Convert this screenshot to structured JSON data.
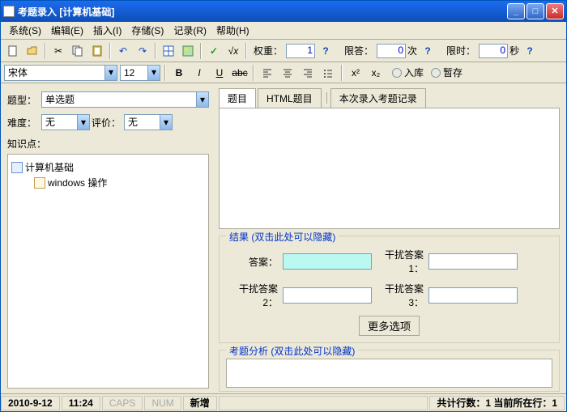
{
  "title": "考题录入 [计算机基础]",
  "menu": [
    "系统(S)",
    "编辑(E)",
    "插入(I)",
    "存储(S)",
    "记录(R)",
    "帮助(H)"
  ],
  "toolbar": {
    "weight_label": "权重：",
    "weight_value": "1",
    "limit_answer_label": "限答：",
    "limit_answer_value": "0",
    "limit_answer_unit": "次",
    "limit_time_label": "限时：",
    "limit_time_value": "0",
    "limit_time_unit": "秒"
  },
  "format": {
    "font": "宋体",
    "size": "12",
    "radio_store": "入库",
    "radio_temp": "暂存"
  },
  "left": {
    "type_label": "题型：",
    "type_value": "单选题",
    "difficulty_label": "难度：",
    "difficulty_value": "无",
    "rating_label": "评价：",
    "rating_value": "无",
    "knowledge_label": "知识点：",
    "tree_root": "计算机基础",
    "tree_child": "windows 操作"
  },
  "tabs": {
    "t1": "题目",
    "t2": "HTML题目",
    "t3": "本次录入考题记录"
  },
  "result": {
    "caption": "结果 (双击此处可以隐藏)",
    "answer_label": "答案：",
    "d1_label": "干扰答案1：",
    "d2_label": "干扰答案2：",
    "d3_label": "干扰答案3：",
    "more": "更多选项"
  },
  "analysis": {
    "caption": "考题分析 (双击此处可以隐藏)"
  },
  "status": {
    "date": "2010-9-12",
    "time": "11:24",
    "caps": "CAPS",
    "num": "NUM",
    "mode": "新增",
    "rows": "共计行数：1 当前所在行：1"
  }
}
